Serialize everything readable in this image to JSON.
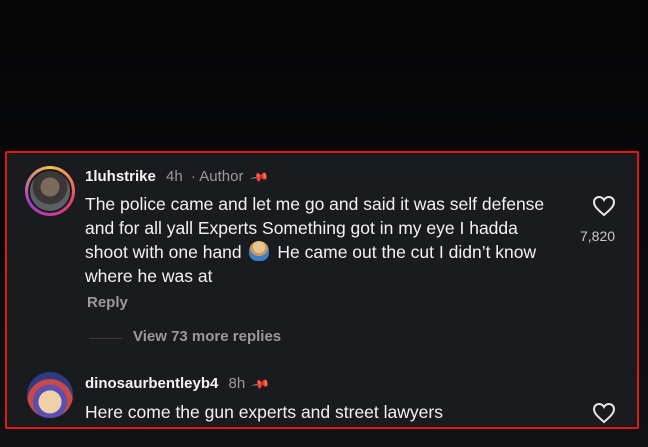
{
  "comments": [
    {
      "username": "1luhstrike",
      "time": "4h",
      "author_tag": "· Author",
      "pin_icon": "pin-icon",
      "text_before_emoji": "The police came and let me go and said it was self defense and for all yall Experts Something got in my eye I hadda shoot with one hand",
      "emoji": "person-emoji",
      "text_after_emoji": "He came out the cut I didn’t know where he was at",
      "likes": "7,820",
      "reply_label": "Reply",
      "view_more_label": "View 73 more replies"
    },
    {
      "username": "dinosaurbentleyb4",
      "time": "8h",
      "pin_icon": "pin-icon",
      "text": "Here come the gun experts and street lawyers"
    }
  ],
  "colors": {
    "highlight_border": "#e01818",
    "panel_bg": "#1a1b1e",
    "muted_text": "#9a9a9a"
  }
}
